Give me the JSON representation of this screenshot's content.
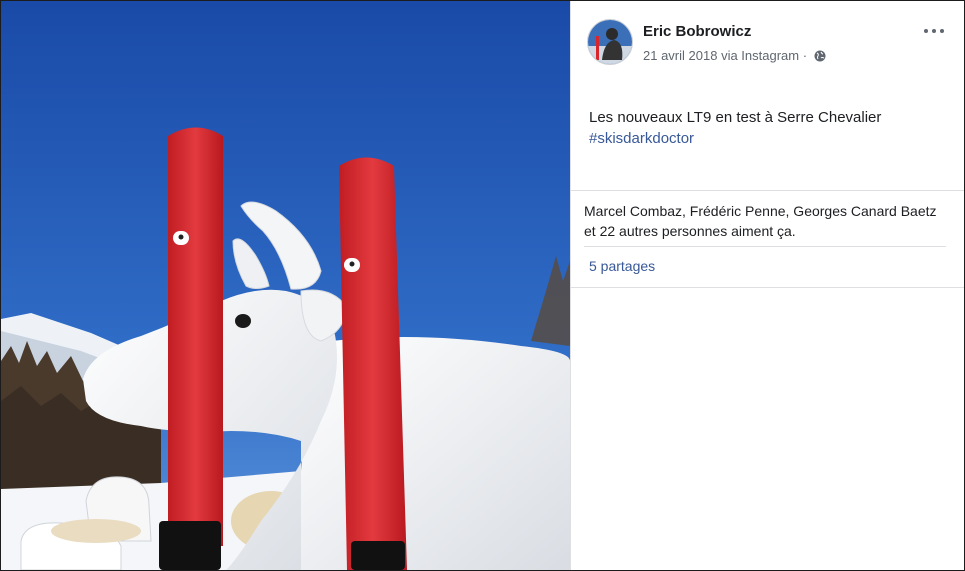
{
  "post": {
    "author": "Eric Bobrowicz",
    "date": "21 avril 2018",
    "via": "via Instagram",
    "separator": "·",
    "privacy_icon": "globe-icon",
    "menu_icon": "more-options-icon",
    "caption": "Les nouveaux LT9 en test à Serre Chevalier",
    "hashtag": "#skisdarkdoctor",
    "likes_text": "Marcel Combaz, Frédéric Penne, Georges Canard Baetz et 22 autres personnes aiment ça.",
    "shares_text": "5 partages"
  },
  "colors": {
    "link": "#385898",
    "text": "#1c1e21",
    "meta": "#606770",
    "ski": "#d8262c",
    "sky_top": "#1b4fb0",
    "sky_bottom": "#4a86d6"
  }
}
